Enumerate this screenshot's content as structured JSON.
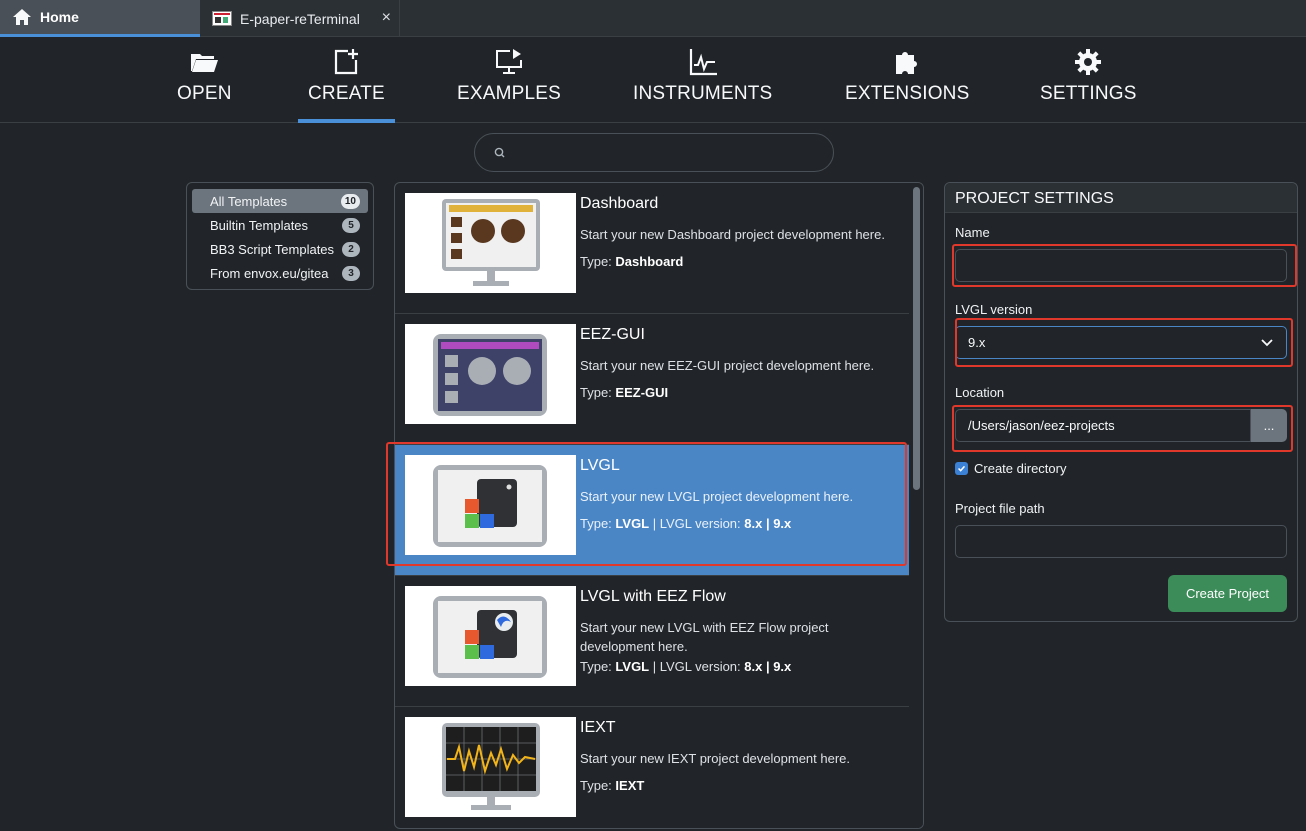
{
  "tabs": [
    {
      "label": "Home",
      "icon": "home-icon"
    },
    {
      "label": "E-paper-reTerminal",
      "icon": "project-icon",
      "close": "×"
    }
  ],
  "nav": [
    {
      "label": "OPEN",
      "icon": "folder-open-icon"
    },
    {
      "label": "CREATE",
      "icon": "create-icon",
      "active": true
    },
    {
      "label": "EXAMPLES",
      "icon": "examples-icon"
    },
    {
      "label": "INSTRUMENTS",
      "icon": "instruments-icon"
    },
    {
      "label": "EXTENSIONS",
      "icon": "puzzle-icon"
    },
    {
      "label": "SETTINGS",
      "icon": "gear-icon"
    }
  ],
  "search": {
    "value": "",
    "placeholder": ""
  },
  "filters": [
    {
      "label": "All Templates",
      "count": "10",
      "active": true
    },
    {
      "label": "Builtin Templates",
      "count": "5"
    },
    {
      "label": "BB3 Script Templates",
      "count": "2"
    },
    {
      "label": "From envox.eu/gitea",
      "count": "3"
    }
  ],
  "templates": [
    {
      "name": "Dashboard",
      "desc": "Start your new Dashboard project development here.",
      "type_prefix": "Type: ",
      "type": "Dashboard",
      "mid": "",
      "versions": ""
    },
    {
      "name": "EEZ-GUI",
      "desc": "Start your new EEZ-GUI project development here.",
      "type_prefix": "Type: ",
      "type": "EEZ-GUI",
      "mid": "",
      "versions": ""
    },
    {
      "name": "LVGL",
      "desc": "Start your new LVGL project development here.",
      "type_prefix": "Type: ",
      "type": "LVGL",
      "mid": " | LVGL version: ",
      "versions": "8.x | 9.x",
      "selected": true
    },
    {
      "name": "LVGL with EEZ Flow",
      "desc": "Start your new LVGL with EEZ Flow project development here.",
      "type_prefix": "Type: ",
      "type": "LVGL",
      "mid": " | LVGL version: ",
      "versions": "8.x | 9.x"
    },
    {
      "name": "IEXT",
      "desc": "Start your new IEXT project development here.",
      "type_prefix": "Type: ",
      "type": "IEXT",
      "mid": "",
      "versions": ""
    }
  ],
  "settings": {
    "title": "PROJECT SETTINGS",
    "name_label": "Name",
    "name_value": "",
    "lvgl_label": "LVGL version",
    "lvgl_value": "9.x",
    "location_label": "Location",
    "location_value": "/Users/jason/eez-projects",
    "browse_label": "...",
    "create_dir_label": "Create directory",
    "create_dir_checked": true,
    "file_path_label": "Project file path",
    "file_path_value": "",
    "create_button": "Create Project"
  },
  "colors": {
    "accent": "#4a90d9",
    "selected_row": "#4a86c5",
    "highlight": "#e0392b",
    "create_button": "#3c8c5a"
  }
}
